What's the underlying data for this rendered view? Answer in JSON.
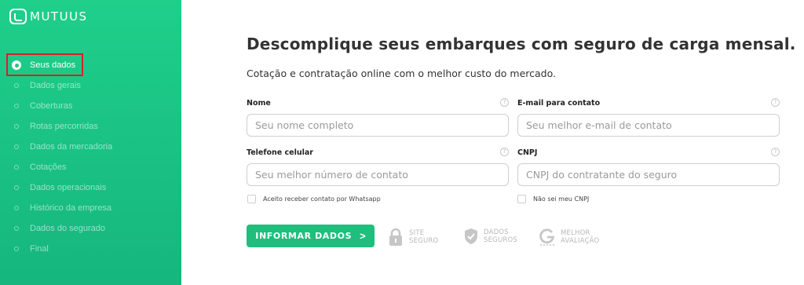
{
  "brand": {
    "name": "MUTUUS"
  },
  "sidebar": {
    "steps": [
      {
        "label": "Seus dados",
        "active": true
      },
      {
        "label": "Dados gerais"
      },
      {
        "label": "Coberturas"
      },
      {
        "label": "Rotas percorridas"
      },
      {
        "label": "Dados da mercadoria"
      },
      {
        "label": "Cotações"
      },
      {
        "label": "Dados operacionais"
      },
      {
        "label": "Histórico da empresa"
      },
      {
        "label": "Dados do segurado"
      },
      {
        "label": "Final"
      }
    ]
  },
  "main": {
    "headline": "Descomplique seus embarques com seguro de carga mensal.",
    "subheadline": "Cotação e contratação online com o melhor custo do mercado.",
    "fields": {
      "nome": {
        "label": "Nome",
        "placeholder": "Seu nome completo",
        "value": ""
      },
      "email": {
        "label": "E-mail para contato",
        "placeholder": "Seu melhor e-mail de contato",
        "value": ""
      },
      "telefone": {
        "label": "Telefone celular",
        "placeholder": "Seu melhor número de contato",
        "value": ""
      },
      "cnpj": {
        "label": "CNPJ",
        "placeholder": "CNPJ do contratante do seguro",
        "value": ""
      }
    },
    "help_glyph": "?",
    "whatsapp_optin": "Aceito receber contato por Whatsapp",
    "no_cnpj": "Não sei meu CNPJ",
    "submit_label": "INFORMAR DADOS",
    "submit_chevron": ">",
    "badges": {
      "site_seguro": [
        "SITE",
        "SEGURO"
      ],
      "dados_seguros": [
        "DADOS",
        "SEGUROS"
      ],
      "melhor_avaliacao": [
        "MELHOR",
        "AVALIAÇÃO"
      ]
    }
  },
  "colors": {
    "accent": "#1fbe7d",
    "sidebar_top": "#1fcf8a",
    "sidebar_bottom": "#16b67e",
    "highlight": "#d6222a"
  }
}
